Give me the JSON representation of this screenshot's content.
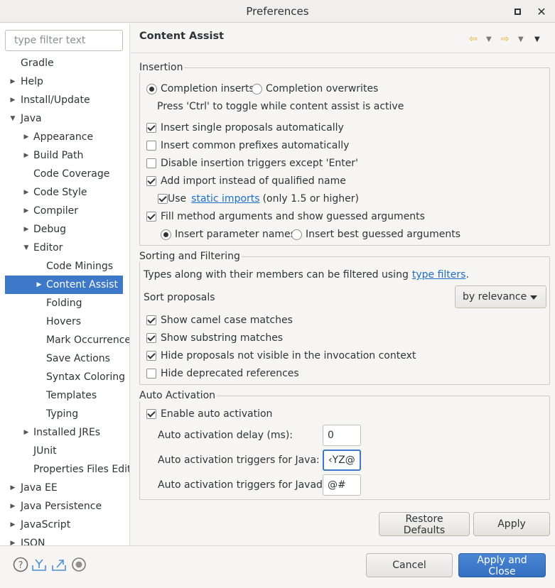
{
  "window": {
    "title": "Preferences"
  },
  "filter": {
    "placeholder": "type filter text"
  },
  "tree": {
    "items": [
      {
        "label": "Gradle",
        "level": 0,
        "arrow": ""
      },
      {
        "label": "Help",
        "level": 0,
        "arrow": "right"
      },
      {
        "label": "Install/Update",
        "level": 0,
        "arrow": "right"
      },
      {
        "label": "Java",
        "level": 0,
        "arrow": "down"
      },
      {
        "label": "Appearance",
        "level": 1,
        "arrow": "right"
      },
      {
        "label": "Build Path",
        "level": 1,
        "arrow": "right"
      },
      {
        "label": "Code Coverage",
        "level": 1,
        "arrow": ""
      },
      {
        "label": "Code Style",
        "level": 1,
        "arrow": "right"
      },
      {
        "label": "Compiler",
        "level": 1,
        "arrow": "right"
      },
      {
        "label": "Debug",
        "level": 1,
        "arrow": "right"
      },
      {
        "label": "Editor",
        "level": 1,
        "arrow": "down"
      },
      {
        "label": "Code Minings",
        "level": 2,
        "arrow": ""
      },
      {
        "label": "Content Assist",
        "level": 2,
        "arrow": "right",
        "selected": true
      },
      {
        "label": "Folding",
        "level": 2,
        "arrow": ""
      },
      {
        "label": "Hovers",
        "level": 2,
        "arrow": ""
      },
      {
        "label": "Mark Occurrence",
        "level": 2,
        "arrow": ""
      },
      {
        "label": "Save Actions",
        "level": 2,
        "arrow": ""
      },
      {
        "label": "Syntax Coloring",
        "level": 2,
        "arrow": ""
      },
      {
        "label": "Templates",
        "level": 2,
        "arrow": ""
      },
      {
        "label": "Typing",
        "level": 2,
        "arrow": ""
      },
      {
        "label": "Installed JREs",
        "level": 1,
        "arrow": "right"
      },
      {
        "label": "JUnit",
        "level": 1,
        "arrow": ""
      },
      {
        "label": "Properties Files Edit",
        "level": 1,
        "arrow": ""
      },
      {
        "label": "Java EE",
        "level": 0,
        "arrow": "right"
      },
      {
        "label": "Java Persistence",
        "level": 0,
        "arrow": "right"
      },
      {
        "label": "JavaScript",
        "level": 0,
        "arrow": "right"
      },
      {
        "label": "JSON",
        "level": 0,
        "arrow": "right"
      }
    ]
  },
  "page": {
    "title": "Content Assist"
  },
  "insertion": {
    "title": "Insertion",
    "completion_inserts": "Completion inserts",
    "completion_overwrites": "Completion overwrites",
    "toggle_hint": "Press 'Ctrl' to toggle while content assist is active",
    "insert_single": "Insert single proposals automatically",
    "insert_common": "Insert common prefixes automatically",
    "disable_triggers": "Disable insertion triggers except 'Enter'",
    "add_import": "Add import instead of qualified name",
    "use_label": "Use",
    "static_imports_link": "static imports",
    "use_suffix": "(only 1.5 or higher)",
    "fill_method": "Fill method arguments and show guessed arguments",
    "insert_param_names": "Insert parameter names",
    "insert_best_guessed": "Insert best guessed arguments"
  },
  "sorting": {
    "title": "Sorting and Filtering",
    "types_text": "Types along with their members can be filtered using",
    "type_filters_link": "type filters",
    "period": ".",
    "sort_proposals_label": "Sort proposals",
    "sort_value": "by relevance",
    "camel_case": "Show camel case matches",
    "substring": "Show substring matches",
    "hide_not_visible": "Hide proposals not visible in the invocation context",
    "hide_deprecated": "Hide deprecated references"
  },
  "auto": {
    "title": "Auto Activation",
    "enable": "Enable auto activation",
    "delay_label": "Auto activation delay (ms):",
    "delay_value": "0",
    "java_label": "Auto activation triggers for Java:",
    "java_value": "‹YZ@",
    "javadoc_label": "Auto activation triggers for Javadoc:",
    "javadoc_value": "@#"
  },
  "buttons": {
    "restore_defaults": "Restore Defaults",
    "apply": "Apply",
    "cancel": "Cancel",
    "apply_close": "Apply and Close"
  },
  "icons": {
    "help": "?",
    "close": "✕",
    "nav_back": "⇦",
    "nav_forward": "⇨",
    "dropdown": "▼",
    "view_menu": "▼"
  },
  "colors": {
    "selection": "#3d78c9",
    "link": "#1c6ec8",
    "accent_nav": "#e8b232"
  }
}
